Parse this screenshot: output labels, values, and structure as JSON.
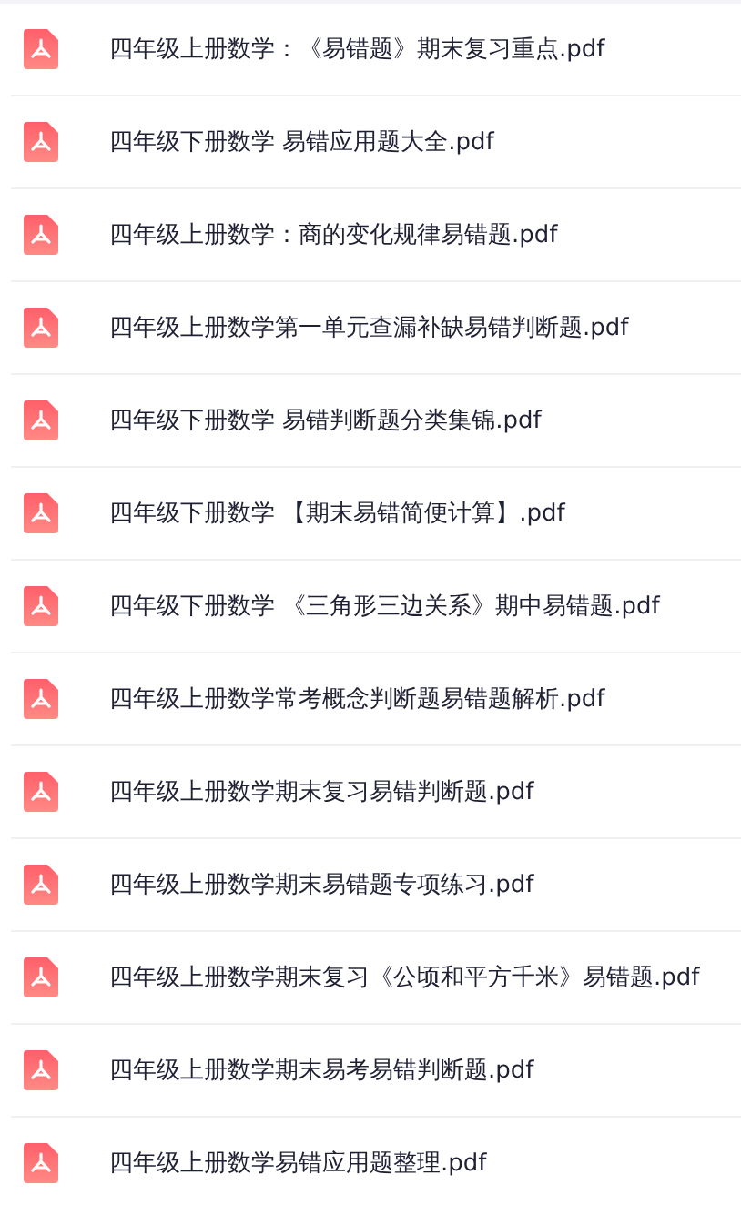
{
  "files": [
    {
      "name": "四年级上册数学：《易错题》期末复习重点.pdf"
    },
    {
      "name": "四年级下册数学 易错应用题大全.pdf"
    },
    {
      "name": "四年级上册数学：商的变化规律易错题.pdf"
    },
    {
      "name": "四年级上册数学第一单元查漏补缺易错判断题.pdf"
    },
    {
      "name": "四年级下册数学 易错判断题分类集锦.pdf"
    },
    {
      "name": "四年级下册数学 【期末易错简便计算】.pdf"
    },
    {
      "name": "四年级下册数学 《三角形三边关系》期中易错题.pdf"
    },
    {
      "name": "四年级上册数学常考概念判断题易错题解析.pdf"
    },
    {
      "name": "四年级上册数学期末复习易错判断题.pdf"
    },
    {
      "name": "四年级上册数学期末易错题专项练习.pdf"
    },
    {
      "name": "四年级上册数学期末复习《公顷和平方千米》易错题.pdf"
    },
    {
      "name": "四年级上册数学期末易考易错判断题.pdf"
    },
    {
      "name": "四年级上册数学易错应用题整理.pdf"
    }
  ]
}
